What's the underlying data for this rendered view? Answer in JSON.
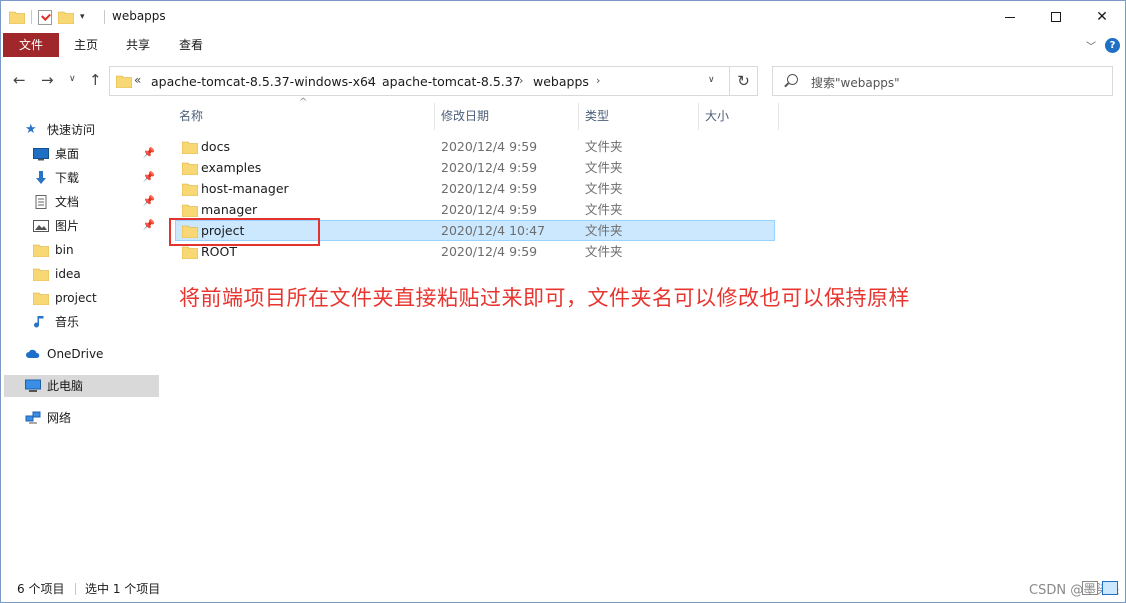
{
  "window": {
    "title": "webapps"
  },
  "ribbon": {
    "file": "文件",
    "home": "主页",
    "share": "共享",
    "view": "查看"
  },
  "address": {
    "overflow": "«",
    "crumbs": [
      "apache-tomcat-8.5.37-windows-x64",
      "apache-tomcat-8.5.37",
      "webapps"
    ],
    "separator": "›"
  },
  "search": {
    "placeholder": "搜索\"webapps\""
  },
  "nav": {
    "quick_access": "快速访问",
    "items": [
      {
        "label": "桌面",
        "icon": "desktop-icon",
        "pinned": true
      },
      {
        "label": "下载",
        "icon": "download-icon",
        "pinned": true
      },
      {
        "label": "文档",
        "icon": "document-icon",
        "pinned": true
      },
      {
        "label": "图片",
        "icon": "picture-icon",
        "pinned": true
      },
      {
        "label": "bin",
        "icon": "folder-icon",
        "pinned": false
      },
      {
        "label": "idea",
        "icon": "folder-icon",
        "pinned": false
      },
      {
        "label": "project",
        "icon": "folder-icon",
        "pinned": false
      },
      {
        "label": "音乐",
        "icon": "music-icon",
        "pinned": false
      }
    ],
    "onedrive": "OneDrive",
    "this_pc": "此电脑",
    "network": "网络"
  },
  "columns": {
    "name": "名称",
    "date": "修改日期",
    "type": "类型",
    "size": "大小"
  },
  "files": [
    {
      "name": "docs",
      "date": "2020/12/4 9:59",
      "type": "文件夹",
      "selected": false
    },
    {
      "name": "examples",
      "date": "2020/12/4 9:59",
      "type": "文件夹",
      "selected": false
    },
    {
      "name": "host-manager",
      "date": "2020/12/4 9:59",
      "type": "文件夹",
      "selected": false
    },
    {
      "name": "manager",
      "date": "2020/12/4 9:59",
      "type": "文件夹",
      "selected": false
    },
    {
      "name": "project",
      "date": "2020/12/4 10:47",
      "type": "文件夹",
      "selected": true
    },
    {
      "name": "ROOT",
      "date": "2020/12/4 9:59",
      "type": "文件夹",
      "selected": false
    }
  ],
  "annotation": "将前端项目所在文件夹直接粘贴过来即可，文件夹名可以修改也可以保持原样",
  "status": {
    "count": "6 个项目",
    "selected": "选中 1 个项目"
  },
  "watermark": "CSDN @墨染&云",
  "colors": {
    "file_tab": "#a0282a",
    "selection": "#cce8ff",
    "annotation": "#e8352f",
    "folder": "#f8d775"
  }
}
